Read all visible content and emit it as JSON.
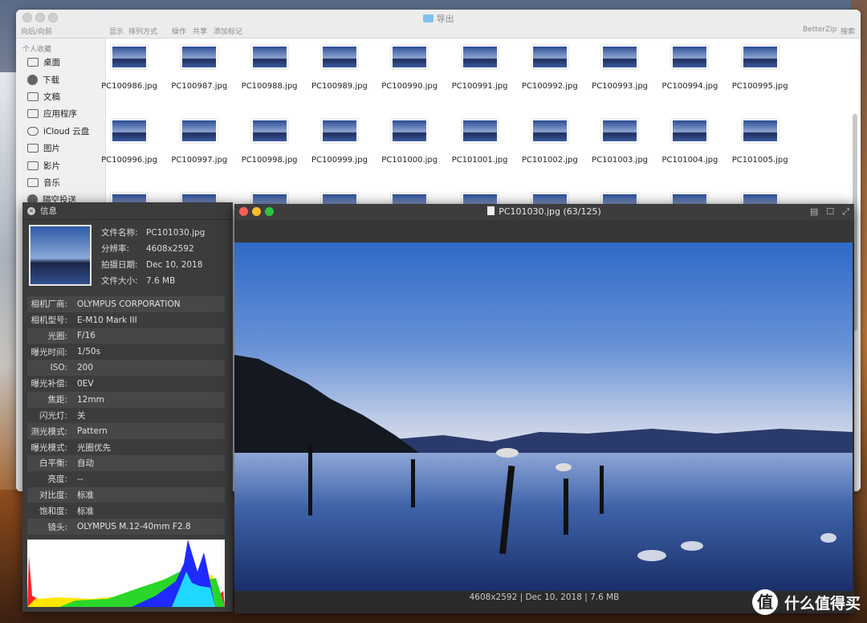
{
  "finder": {
    "title": "导出",
    "toolbar": [
      "向后/向前",
      "显示",
      "排列方式",
      "操作",
      "共享",
      "添加标记"
    ],
    "toolbar_right": [
      "BetterZip",
      "搜索"
    ],
    "sidebar_heading": "个人收藏",
    "sidebar": [
      "桌面",
      "下载",
      "文稿",
      "应用程序",
      "iCloud 云盘",
      "图片",
      "影片",
      "音乐",
      "隔空投送"
    ],
    "files_row1": [
      "PC100986.jpg",
      "PC100987.jpg",
      "PC100988.jpg",
      "PC100989.jpg",
      "PC100990.jpg",
      "PC100991.jpg",
      "PC100992.jpg",
      "PC100993.jpg",
      "PC100994.jpg",
      "PC100995.jpg"
    ],
    "files_row2": [
      "PC100996.jpg",
      "PC100997.jpg",
      "PC100998.jpg",
      "PC100999.jpg",
      "PC101000.jpg",
      "PC101001.jpg",
      "PC101002.jpg",
      "PC101003.jpg",
      "PC101004.jpg",
      "PC101005.jpg"
    ]
  },
  "info": {
    "title": "信息",
    "summary": [
      {
        "k": "文件名称:",
        "v": "PC101030.jpg"
      },
      {
        "k": "分辨率:",
        "v": "4608x2592"
      },
      {
        "k": "拍摄日期:",
        "v": "Dec 10, 2018"
      },
      {
        "k": "文件大小:",
        "v": "7.6 MB"
      }
    ],
    "exif": [
      {
        "k": "相机厂商:",
        "v": "OLYMPUS CORPORATION"
      },
      {
        "k": "相机型号:",
        "v": "E-M10 Mark III"
      },
      {
        "k": "光圈:",
        "v": "F/16"
      },
      {
        "k": "曝光时间:",
        "v": "1/50s"
      },
      {
        "k": "ISO:",
        "v": "200"
      },
      {
        "k": "曝光补偿:",
        "v": "0EV"
      },
      {
        "k": "焦距:",
        "v": "12mm"
      },
      {
        "k": "闪光灯:",
        "v": "关"
      },
      {
        "k": "测光模式:",
        "v": "Pattern"
      },
      {
        "k": "曝光模式:",
        "v": "光圈优先"
      },
      {
        "k": "白平衡:",
        "v": "自动"
      },
      {
        "k": "亮度:",
        "v": "--"
      },
      {
        "k": "对比度:",
        "v": "标准"
      },
      {
        "k": "饱和度:",
        "v": "标准"
      },
      {
        "k": "镜头:",
        "v": "OLYMPUS M.12-40mm F2.8"
      }
    ]
  },
  "viewer": {
    "title": "PC101030.jpg (63/125)",
    "caption": "4608x2592 | Dec 10, 2018 | 7.6 MB"
  },
  "watermark": {
    "badge": "值",
    "text": "什么值得买"
  },
  "colors": {
    "close": "#fe5f57",
    "minimize": "#febc2e",
    "zoom": "#28c840"
  }
}
